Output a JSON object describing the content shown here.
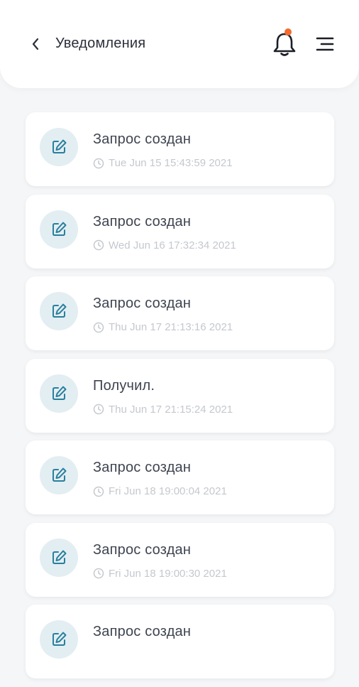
{
  "header": {
    "title": "Уведомления",
    "back_icon": "chevron-left-icon",
    "bell_icon": "bell-icon",
    "menu_icon": "menu-icon",
    "badge_color": "#f26b2f"
  },
  "notifications": [
    {
      "title": "Запрос создан",
      "time": "Tue Jun 15 15:43:59 2021",
      "icon": "edit-icon"
    },
    {
      "title": "Запрос создан",
      "time": "Wed Jun 16 17:32:34 2021",
      "icon": "edit-icon"
    },
    {
      "title": "Запрос создан",
      "time": "Thu Jun 17 21:13:16 2021",
      "icon": "edit-icon"
    },
    {
      "title": "Получил.",
      "time": "Thu Jun 17 21:15:24 2021",
      "icon": "edit-icon"
    },
    {
      "title": "Запрос создан",
      "time": "Fri Jun 18 19:00:04 2021",
      "icon": "edit-icon"
    },
    {
      "title": "Запрос создан",
      "time": "Fri Jun 18 19:00:30 2021",
      "icon": "edit-icon"
    },
    {
      "title": "Запрос создан",
      "time": "",
      "icon": "edit-icon"
    }
  ],
  "colors": {
    "accent": "#2a7f9e",
    "icon_bg": "#e3eef2",
    "background": "#f4f6f8"
  }
}
